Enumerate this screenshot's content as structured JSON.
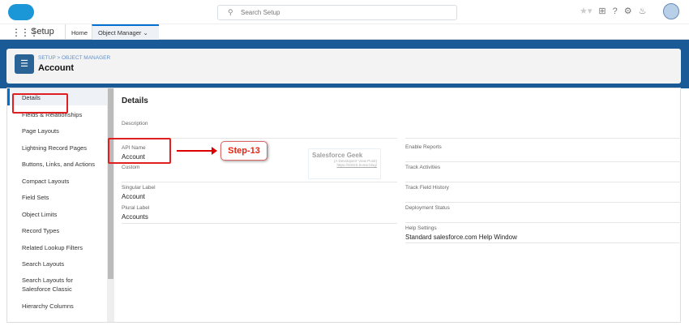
{
  "header": {
    "search_placeholder": "Search Setup"
  },
  "nav": {
    "app": "Setup",
    "tabs": [
      {
        "label": "Home"
      },
      {
        "label": "Object Manager",
        "active": true
      }
    ]
  },
  "object": {
    "breadcrumb": "SETUP > OBJECT MANAGER",
    "title": "Account"
  },
  "sidebar": {
    "items": [
      "Details",
      "Fields & Relationships",
      "Page Layouts",
      "Lightning Record Pages",
      "Buttons, Links, and Actions",
      "Compact Layouts",
      "Field Sets",
      "Object Limits",
      "Record Types",
      "Related Lookup Filters",
      "Search Layouts",
      "Search Layouts for Salesforce Classic",
      "Hierarchy Columns"
    ]
  },
  "details": {
    "title": "Details",
    "left": [
      {
        "label": "Description",
        "value": ""
      },
      {
        "label": "API Name",
        "value": "Account"
      },
      {
        "label": "Custom",
        "value": ""
      },
      {
        "label": "Singular Label",
        "value": "Account"
      },
      {
        "label": "Plural Label",
        "value": "Accounts"
      }
    ],
    "right": [
      {
        "label": "Enable Reports",
        "value": ""
      },
      {
        "label": "Track Activities",
        "value": ""
      },
      {
        "label": "Track Field History",
        "value": ""
      },
      {
        "label": "Deployment Status",
        "value": ""
      },
      {
        "label": "Help Settings",
        "value": "Standard salesforce.com Help Window"
      }
    ]
  },
  "annotation": {
    "step": "Step-13"
  },
  "watermark": {
    "title": "Salesforce Geek",
    "subtitle": "(A Developers' View Point)",
    "url": "https://SSGS.home.blog/"
  }
}
